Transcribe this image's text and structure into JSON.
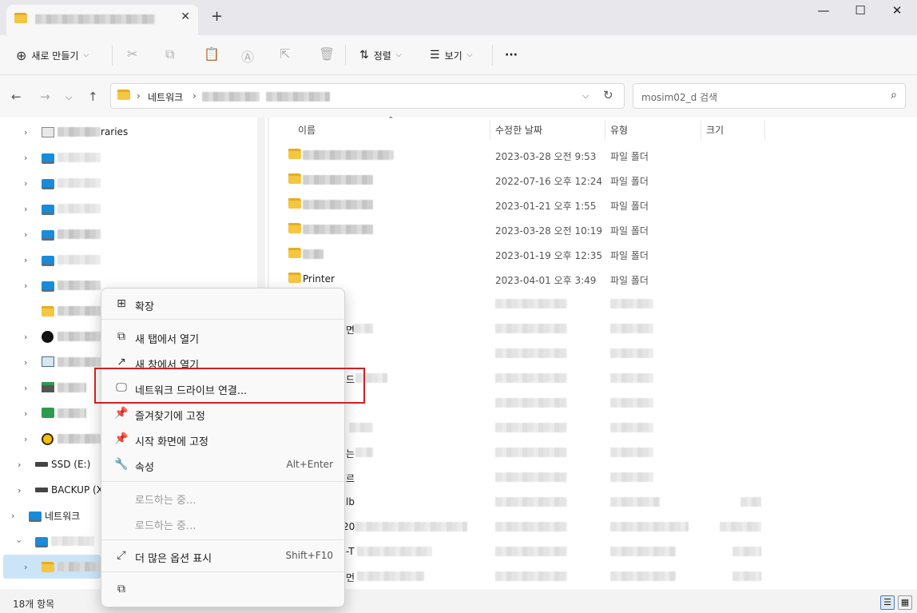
{
  "window": {
    "tab_title": "",
    "new_tab": "+",
    "tab_close": "✕",
    "minimize": "—",
    "maximize": "☐",
    "close": "✕"
  },
  "toolbar": {
    "new_label": "새로 만들기",
    "sort_label": "정렬",
    "view_label": "보기",
    "more_label": "···"
  },
  "address": {
    "root": "네트워크",
    "separator": "›"
  },
  "search": {
    "placeholder": "mosim02_d 검색"
  },
  "navpane": {
    "items": [
      {
        "label": "raries",
        "icon": "libraries-icon"
      },
      {
        "label": "",
        "icon": "computer-icon"
      },
      {
        "label": "",
        "icon": "computer-icon"
      },
      {
        "label": "",
        "icon": "computer-icon"
      },
      {
        "label": "",
        "icon": "computer-icon"
      },
      {
        "label": "",
        "icon": "computer-icon"
      },
      {
        "label": "",
        "icon": "computer-icon"
      },
      {
        "label": "",
        "icon": "folder-icon"
      },
      {
        "label": "",
        "icon": "unreal-icon"
      },
      {
        "label": "",
        "icon": "control-panel-icon"
      },
      {
        "label": "",
        "icon": "printer-icon"
      },
      {
        "label": "",
        "icon": "share-icon"
      },
      {
        "label": "",
        "icon": "kakaotalk-icon"
      }
    ],
    "ssd": "SSD (E:)",
    "backup": "BACKUP (X:",
    "network": "네트워크"
  },
  "columns": {
    "name": "이름",
    "modified": "수정한 날짜",
    "type": "유형",
    "size": "크기"
  },
  "files": [
    {
      "name": "",
      "date": "2023-03-28 오전 9:53",
      "type": "파일 폴더"
    },
    {
      "name": "",
      "date": "2022-07-16 오후 12:24",
      "type": "파일 폴더"
    },
    {
      "name": "",
      "date": "2023-01-21 오후 1:55",
      "type": "파일 폴더"
    },
    {
      "name": "",
      "date": "2023-03-28 오전 10:19",
      "type": "파일 폴더"
    },
    {
      "name": "",
      "date": "2023-01-19 오후 12:35",
      "type": "파일 폴더"
    },
    {
      "name": "Printer",
      "date": "2023-04-01 오후 3:49",
      "type": "파일 폴더"
    }
  ],
  "partial_names": [
    "면",
    "드",
    "는",
    "르",
    "lb",
    "20",
    "-T",
    "먼"
  ],
  "status": {
    "count": "18개 항목"
  },
  "context_menu": {
    "expand": "확장",
    "open_new_tab": "새 탭에서 열기",
    "open_new_window": "새 창에서 열기",
    "map_drive": "네트워크 드라이브 연결...",
    "pin_quick": "즐겨찾기에 고정",
    "pin_start": "시작 화면에 고정",
    "properties": "속성",
    "properties_shortcut": "Alt+Enter",
    "loading1": "로드하는 중...",
    "loading2": "로드하는 중...",
    "more_options": "더 많은 옵션 표시",
    "more_options_shortcut": "Shift+F10"
  },
  "colors": {
    "highlight_box": "#d42020",
    "accent": "#1570b5",
    "folder": "#f4c642"
  }
}
